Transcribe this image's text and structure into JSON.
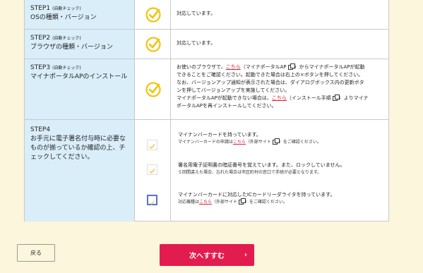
{
  "rows": [
    {
      "step": "STEP1",
      "auto": "(自動チェック)",
      "desc": "OSの種類・バージョン",
      "text": "対応しています。"
    },
    {
      "step": "STEP2",
      "auto": "(自動チェック)",
      "desc": "ブラウザの種類・バージョン",
      "text": "対応しています。"
    },
    {
      "step": "STEP3",
      "auto": "(自動チェック)",
      "desc": "マイナポータルAPのインストール",
      "line1a": "お使いのブラウザで、",
      "link1": "こちら",
      "line1b": "（マイナポータルAP",
      "line1c": "）からマイナポータルAPが起動",
      "line2": "できることをご確認ください。起動できた場合は右上の×ボタンを押してください。",
      "line3": "なお、バージョンアップ通知が表示された場合は、ダイアログボックス内の更新ボタ",
      "line4": "ンを押してバージョンアップを実施してください。",
      "line5a": "マイナポータルAPが起動できない場合は、",
      "link2": "こちら",
      "line5b": "（インストール手順",
      "line5c": "）よりマイナ",
      "line6": "ポータルAPを再インストールしてください。"
    },
    {
      "step": "STEP4",
      "desc": "お手元に電子署名付与時に必要なものが揃っているか確認の上、チェックしてください。",
      "items": [
        {
          "main": "マイナンバーカードを持っています。",
          "sub_a": "マイナンバーカードの申請は",
          "sub_link": "こちら",
          "sub_b": "（外部サイト",
          "sub_c": "）をご確認ください。"
        },
        {
          "main": "署名用電子証明書の暗証番号を覚えています。また、ロックしていません。",
          "sub": "５回間違えた場合、忘れた場合は市区町村の窓口で手続が必要となります。"
        },
        {
          "main": "マイナンバーカードに対応したICカードリーダライタを持っています。",
          "sub_a": "対応機種は",
          "sub_link": "こちら",
          "sub_b": "（外部サイト",
          "sub_c": "）をご確認ください。"
        }
      ]
    }
  ],
  "buttons": {
    "back": "戻る",
    "next": "次へすすむ"
  },
  "colors": {
    "check": "#f1c40f",
    "accent": "#e31c4f",
    "link": "#dd2233"
  }
}
